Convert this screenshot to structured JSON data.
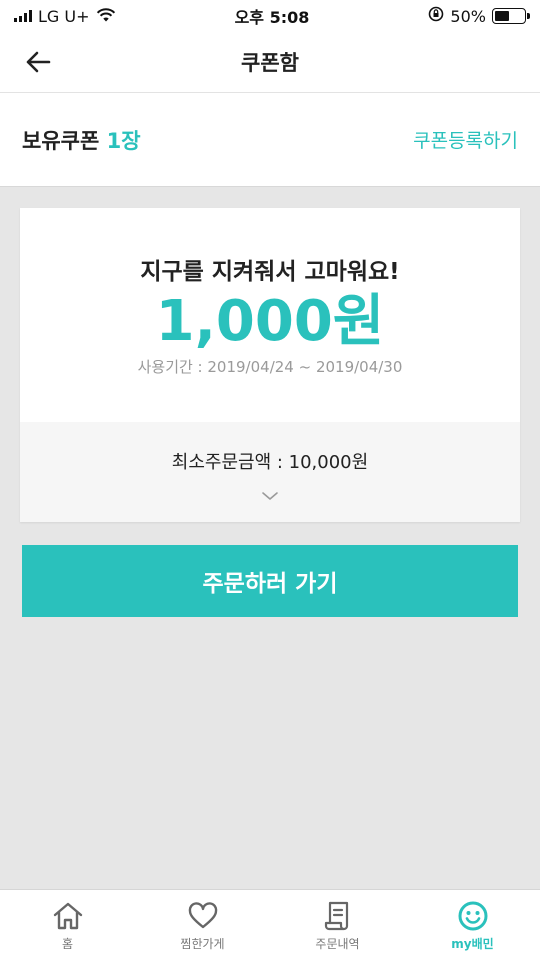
{
  "status_bar": {
    "carrier": "LG U+",
    "time": "오후 5:08",
    "battery_percent": "50%",
    "battery_level": 0.5
  },
  "header": {
    "title": "쿠폰함",
    "back_icon": "arrow-left-icon"
  },
  "summary": {
    "label": "보유쿠폰",
    "count": "1장",
    "register_link": "쿠폰등록하기"
  },
  "coupon": {
    "name": "지구를 지켜줘서 고마워요!",
    "amount": "1,000원",
    "period": "사용기간 : 2019/04/24 ~ 2019/04/30",
    "min_order": "최소주문금액 : 10,000원",
    "expand_icon": "chevron-down-icon"
  },
  "order_button": {
    "label": "주문하러 가기"
  },
  "tab_bar": {
    "items": [
      {
        "label": "홈",
        "icon": "home-icon",
        "active": false
      },
      {
        "label": "찜한가게",
        "icon": "heart-icon",
        "active": false
      },
      {
        "label": "주문내역",
        "icon": "receipt-icon",
        "active": false
      },
      {
        "label": "my배민",
        "icon": "smile-icon",
        "active": true
      }
    ]
  },
  "colors": {
    "accent": "#2ac1bc",
    "background": "#e6e6e6",
    "text": "#222222",
    "muted": "#9a9a9a"
  }
}
